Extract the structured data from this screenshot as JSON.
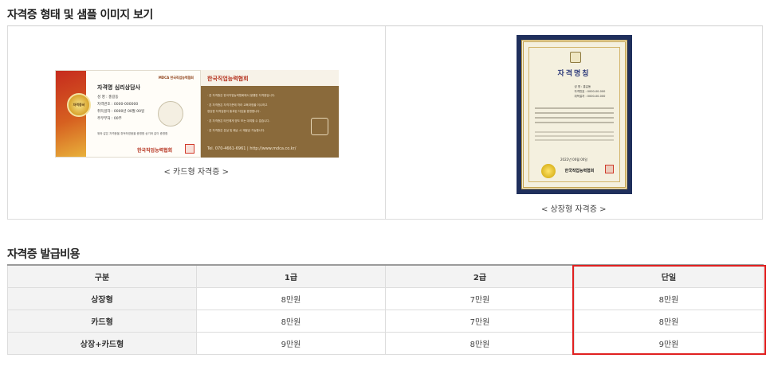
{
  "sections": {
    "sample_title": "자격증 형태 및 샘플 이미지 보기",
    "fee_title": "자격증 발급비용"
  },
  "card_sample": {
    "caption": "< 카드형 자격증 >",
    "front": {
      "brand_top": "MDCA 한국직업능력협회",
      "seal_text": "자격증서",
      "kind": "자격명 심리상담사",
      "rows": [
        "성     명 : 홍길동",
        "자격번호 : 0000-000000",
        "취득일자 : 0000년 00월 00일",
        "주무부처 : 00부"
      ],
      "note": "위와 같은 자격증을 취득하였음을 증명함 상기와 같이 증명함",
      "brand_bottom": "한국직업능력협회"
    },
    "back": {
      "header": "한국직업능력협회",
      "lines": [
        "· 본 자격증은 한국직업능력협회에서 발행한 자격증입니다.",
        "· 본 자격증은 자격기준에 따라 교육과정을 이수하고",
        "  정당한 자격검증이 통과된 자임을 증명합니다.",
        "· 본 자격증은 타인에게 양도 또는 대여할 수 없습니다.",
        "· 본 자격증은 분실 및 훼손 시 재발급 가능합니다."
      ],
      "tel": "Tel. 070-4661-6961  |  http://www.mdca.co.kr/"
    }
  },
  "cert_sample": {
    "caption": "< 상장형 자격증 >",
    "title": "자격명칭",
    "meta": [
      "성    명 : 홍길동",
      "자격번호 : 0000-00-000",
      "취득일자 : 0000-00-000"
    ],
    "date": "2022년  00월  00일",
    "org": "한국직업능력협회"
  },
  "fee_table": {
    "headers": [
      "구분",
      "1급",
      "2급",
      "단일"
    ],
    "rows": [
      {
        "label": "상장형",
        "values": [
          "8만원",
          "7만원",
          "8만원"
        ]
      },
      {
        "label": "카드형",
        "values": [
          "8만원",
          "7만원",
          "8만원"
        ]
      },
      {
        "label": "상장+카드형",
        "values": [
          "9만원",
          "8만원",
          "9만원"
        ]
      }
    ],
    "highlight_color": "#e02020"
  }
}
